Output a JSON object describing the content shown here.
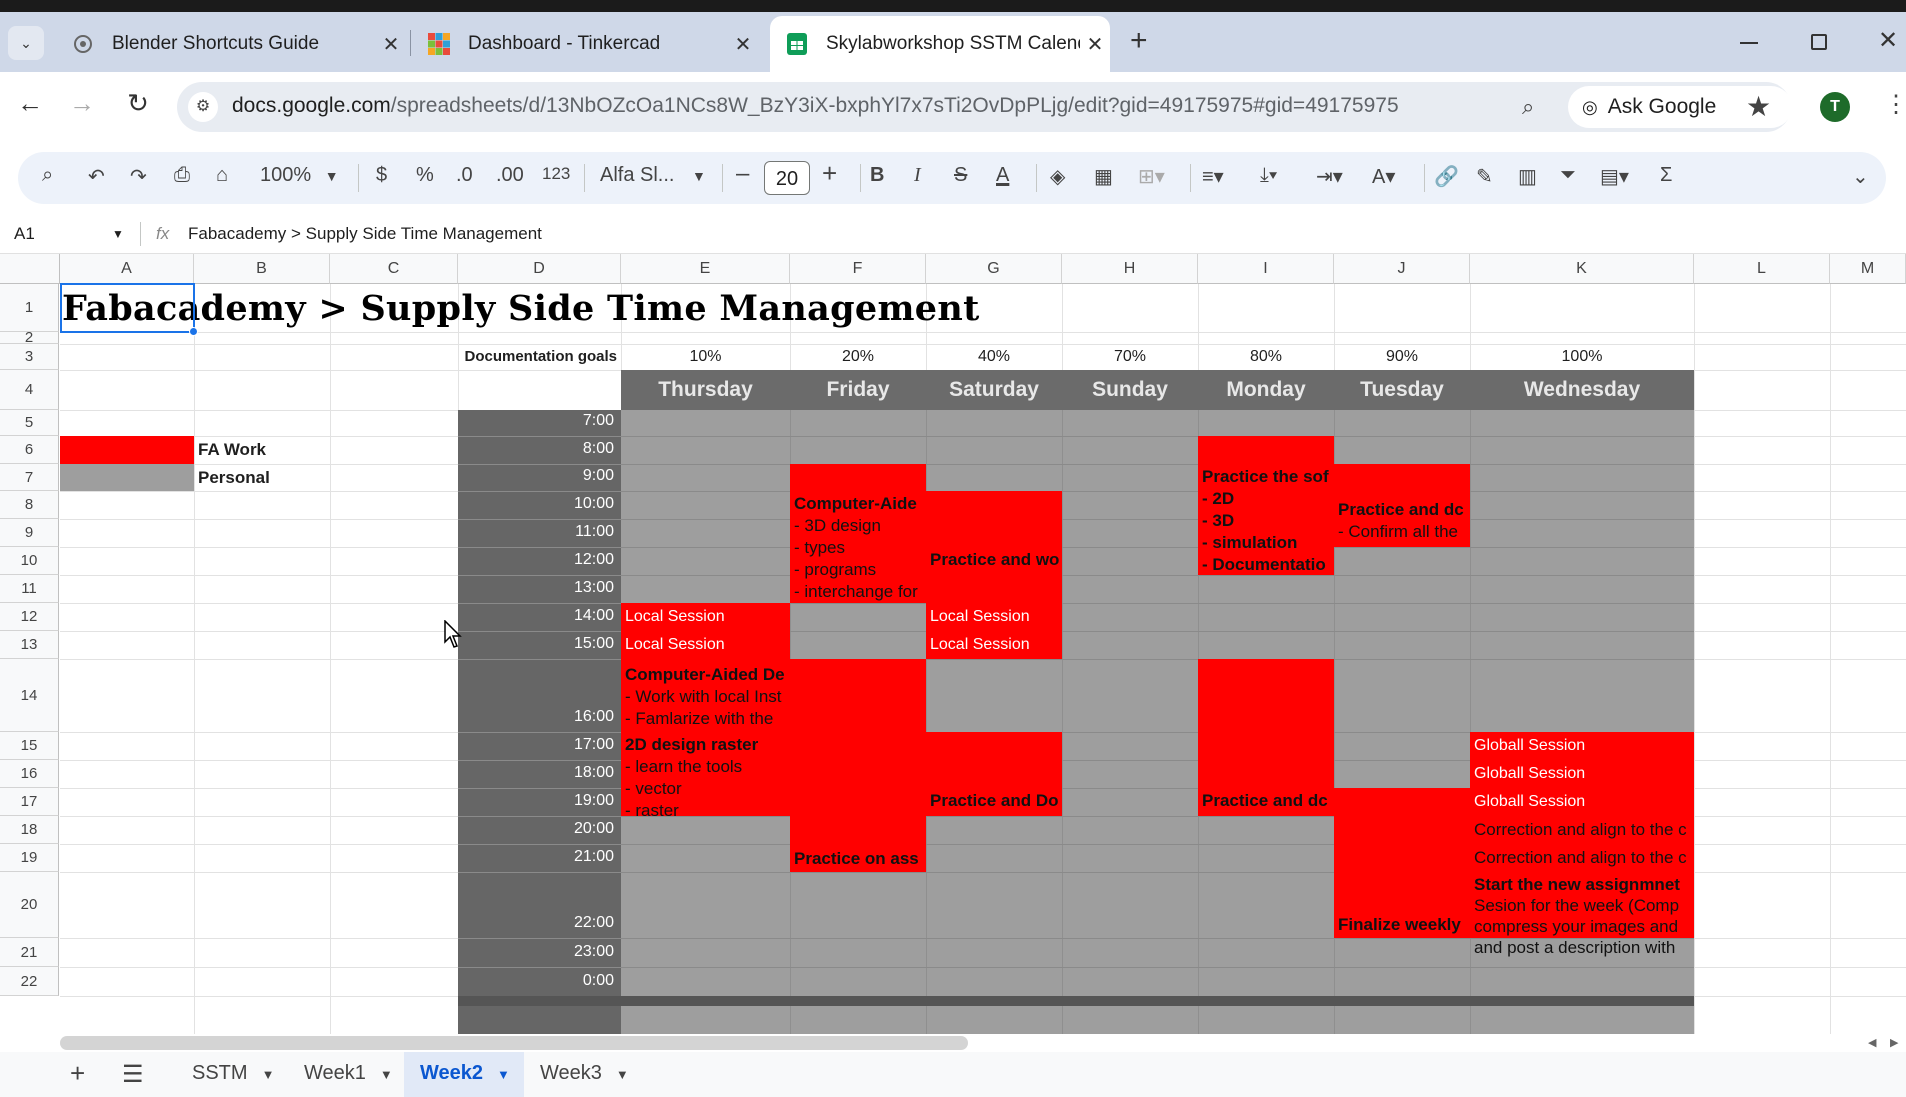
{
  "browser": {
    "tabs": [
      {
        "title": "Blender Shortcuts Guide",
        "close": "✕"
      },
      {
        "title": "Dashboard - Tinkercad",
        "close": "✕"
      },
      {
        "title": "Skylabworkshop SSTM Calenda",
        "close": "✕"
      }
    ],
    "new_tab": "+",
    "url_host": "docs.google.com",
    "url_path": "/spreadsheets/d/13NbOZcOa1NCs8W_BzY3iX-bxphYl7x7sTi2OvDpPLjg/edit?gid=49175975#gid=49175975",
    "ask_google": "Ask Google",
    "avatar_letter": "T"
  },
  "toolbar": {
    "zoom": "100%",
    "currency": "$",
    "percent": "%",
    "dec_decrease": ".0",
    "dec_increase": ".00",
    "number_format": "123",
    "font": "Alfa Sl...",
    "font_size": "20",
    "minus": "–",
    "plus": "+",
    "bold": "B",
    "italic": "I",
    "strike": "S",
    "text_color": "A"
  },
  "formula_bar": {
    "cell_ref": "A1",
    "fx": "fx",
    "content": "Fabacademy > Supply Side Time Management"
  },
  "columns": [
    "A",
    "B",
    "C",
    "D",
    "E",
    "F",
    "G",
    "H",
    "I",
    "J",
    "K",
    "L",
    "M"
  ],
  "rows": [
    "1",
    "2",
    "3",
    "4",
    "5",
    "6",
    "7",
    "8",
    "9",
    "10",
    "11",
    "12",
    "13",
    "14",
    "15",
    "16",
    "17",
    "18",
    "19",
    "20",
    "21",
    "22"
  ],
  "sheet": {
    "title": "Fabacademy > Supply Side Time Management",
    "doc_goals_label": "Documentation goals",
    "goals": [
      "10%",
      "20%",
      "40%",
      "70%",
      "80%",
      "90%",
      "100%"
    ],
    "days": [
      "Thursday",
      "Friday",
      "Saturday",
      "Sunday",
      "Monday",
      "Tuesday",
      "Wednesday"
    ],
    "legend": [
      {
        "label": "FA Work",
        "color": "#ff0000"
      },
      {
        "label": "Personal",
        "color": "#9e9e9e"
      }
    ],
    "times": [
      "7:00",
      "8:00",
      "9:00",
      "10:00",
      "11:00",
      "12:00",
      "13:00",
      "14:00",
      "15:00",
      "16:00",
      "17:00",
      "18:00",
      "19:00",
      "20:00",
      "21:00",
      "22:00",
      "23:00",
      "0:00"
    ],
    "events": {
      "thu_local1": "Local Session",
      "thu_local2": "Local Session",
      "thu_cad_title": "Computer-Aided De",
      "thu_cad_l1": "- Work with local Inst",
      "thu_cad_l2": "- Famlarize with the",
      "thu_2d_title": "2D design raster",
      "thu_2d_l1": "- learn the tools",
      "thu_2d_l2": "- vector",
      "thu_2d_l3": "- raster",
      "fri_cad_title": "Computer-Aide",
      "fri_cad_l1": "- 3D design",
      "fri_cad_l2": "- types",
      "fri_cad_l3": "- programs",
      "fri_cad_l4": "- interchange for",
      "fri_practice": "Practice on ass",
      "sat_practice1": "Practice and wo",
      "sat_local1": "Local Session",
      "sat_local2": "Local Session",
      "sat_practice2": "Practice and Do",
      "mon_title": "Practice the sof",
      "mon_l1": "- 2D",
      "mon_l2": "- 3D",
      "mon_l3": "- simulation",
      "mon_l4": "- Documentatio",
      "mon_practice": "Practice and dc",
      "tue_title": "Practice and dc",
      "tue_l1": "- Confirm all the",
      "tue_finalize": "Finalize weekly",
      "wed_global1": "Globall Session",
      "wed_global2": "Globall Session",
      "wed_global3": "Globall Session",
      "wed_corr1": "Correction and align to the c",
      "wed_corr2": "Correction and align to the c",
      "wed_new_title": "Start the new assignmnet",
      "wed_new_l1": "Sesion for the week (Comp",
      "wed_new_l2": "compress your images and",
      "wed_new_l3": "and post a description with"
    }
  },
  "sheet_tabs": [
    "SSTM",
    "Week1",
    "Week2",
    "Week3"
  ],
  "colors": {
    "fa_work": "#ff0000",
    "personal": "#9e9e9e",
    "time_col": "#666666",
    "day_header": "#6b6b6b"
  }
}
